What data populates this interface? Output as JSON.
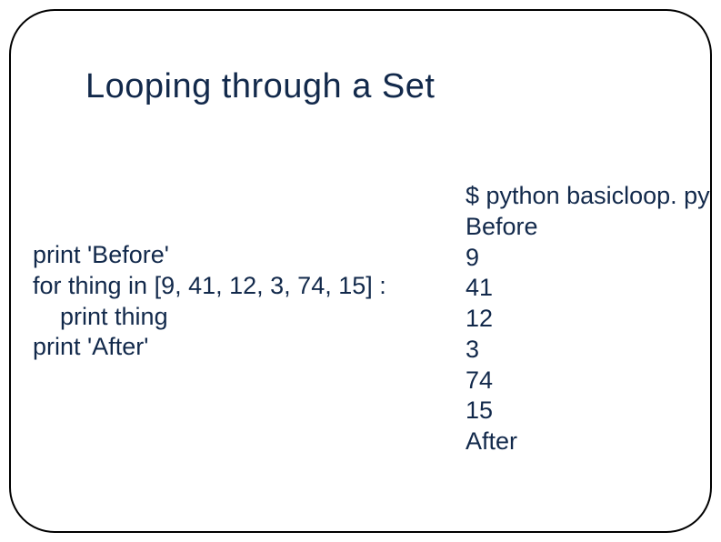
{
  "title": "Looping through a Set",
  "code": {
    "line1": "print 'Before'",
    "line2": "for thing in [9, 41, 12, 3, 74, 15] :",
    "line3": "    print thing",
    "line4": "print 'After'"
  },
  "output": {
    "line1": "$ python basicloop. py",
    "line2": "Before",
    "line3": "9",
    "line4": "41",
    "line5": "12",
    "line6": "3",
    "line7": "74",
    "line8": "15",
    "line9": "After"
  }
}
